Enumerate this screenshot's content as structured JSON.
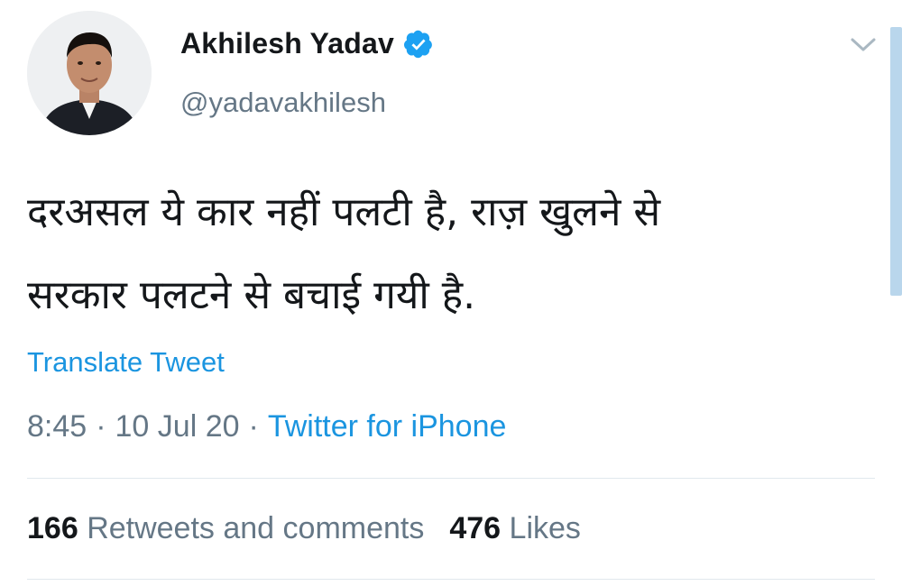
{
  "author": {
    "display_name": "Akhilesh Yadav",
    "handle": "@yadavakhilesh",
    "verified": true,
    "avatar_icon": "profile-photo"
  },
  "tweet": {
    "text_line1": "दरअसल ये कार नहीं पलटी है, राज़ खुलने से",
    "text_line2": "सरकार पलटने से बचाई गयी है."
  },
  "translate_label": "Translate Tweet",
  "meta": {
    "time": "8:45",
    "separator": "·",
    "date": "10 Jul 20",
    "source": "Twitter for iPhone"
  },
  "stats": {
    "retweets_count": "166",
    "retweets_label": "Retweets and comments",
    "likes_count": "476",
    "likes_label": "Likes"
  },
  "colors": {
    "link_blue": "#1b95e0",
    "secondary_text": "#657786",
    "verified_blue": "#1da1f2"
  },
  "icons": [
    "verified-badge-icon",
    "chevron-down-icon"
  ]
}
